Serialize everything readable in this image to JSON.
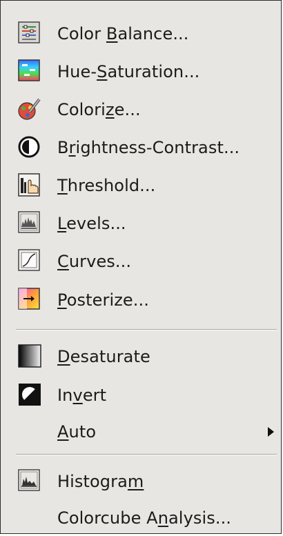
{
  "menu": {
    "items": [
      {
        "id": "color-balance",
        "pre": "Color ",
        "mn": "B",
        "post": "alance...",
        "icon": "color-balance-icon"
      },
      {
        "id": "hue-saturation",
        "pre": "Hue-",
        "mn": "S",
        "post": "aturation...",
        "icon": "hue-saturation-icon"
      },
      {
        "id": "colorize",
        "pre": "Colori",
        "mn": "z",
        "post": "e...",
        "icon": "colorize-icon"
      },
      {
        "id": "brightness-contrast",
        "pre": "B",
        "mn": "r",
        "post": "ightness-Contrast...",
        "icon": "brightness-contrast-icon"
      },
      {
        "id": "threshold",
        "pre": "",
        "mn": "T",
        "post": "hreshold...",
        "icon": "threshold-icon"
      },
      {
        "id": "levels",
        "pre": "",
        "mn": "L",
        "post": "evels...",
        "icon": "levels-icon"
      },
      {
        "id": "curves",
        "pre": "",
        "mn": "C",
        "post": "urves...",
        "icon": "curves-icon"
      },
      {
        "id": "posterize",
        "pre": "",
        "mn": "P",
        "post": "osterize...",
        "icon": "posterize-icon"
      },
      {
        "id": "desaturate",
        "pre": "",
        "mn": "D",
        "post": "esaturate",
        "icon": "desaturate-icon"
      },
      {
        "id": "invert",
        "pre": "In",
        "mn": "v",
        "post": "ert",
        "icon": "invert-icon"
      },
      {
        "id": "auto",
        "pre": "",
        "mn": "A",
        "post": "uto",
        "icon": "",
        "submenu": true
      },
      {
        "id": "histogram",
        "pre": "Histogra",
        "mn": "m",
        "post": "",
        "icon": "histogram-icon"
      },
      {
        "id": "colorcube-analysis",
        "pre": "Colorcube A",
        "mn": "n",
        "post": "alysis...",
        "icon": ""
      }
    ]
  },
  "colors": {
    "menu_bg": "#e8e6e2",
    "text": "#1b1b1b",
    "separator": "#a8a6a2"
  }
}
